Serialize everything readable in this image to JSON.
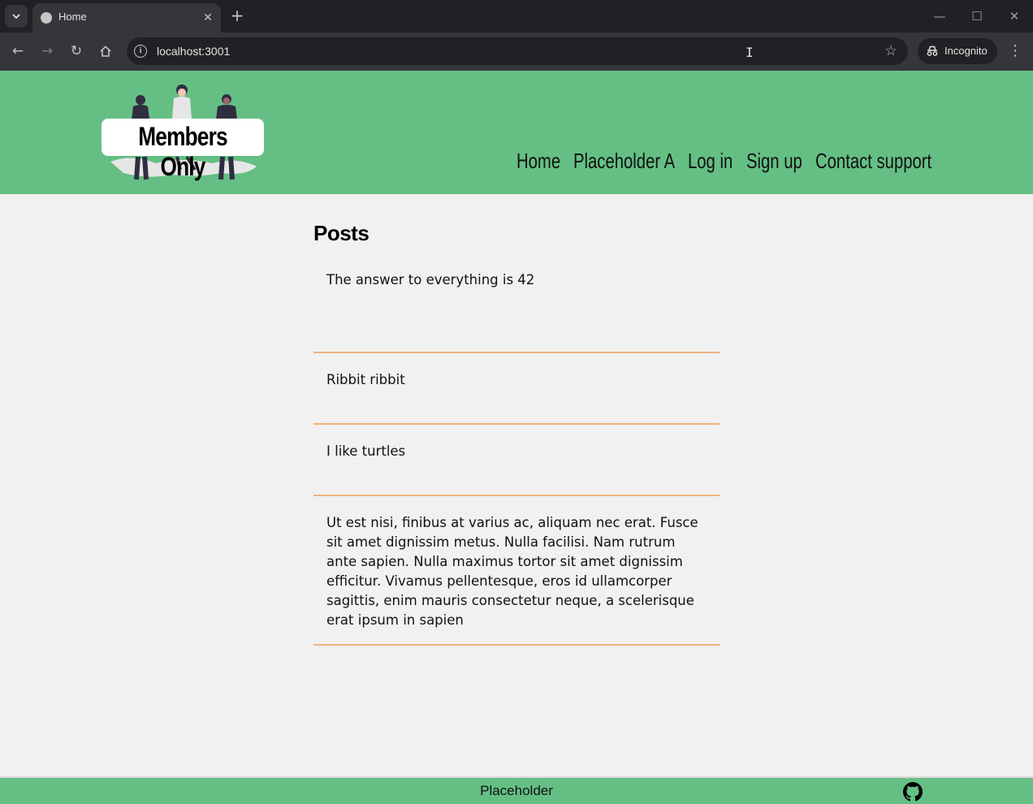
{
  "browser": {
    "tab_title": "Home",
    "url": "localhost:3001",
    "incognito_label": "Incognito",
    "icons": [
      "tab-search-icon",
      "globe-icon",
      "close-icon",
      "plus-icon",
      "minimize-icon",
      "maximize-icon",
      "back-icon",
      "forward-icon",
      "reload-icon",
      "home-icon",
      "site-info-icon",
      "bookmark-star-icon",
      "incognito-icon",
      "menu-icon"
    ]
  },
  "header": {
    "logo_text": "Members Only",
    "nav": [
      "Home",
      "Placeholder A",
      "Log in",
      "Sign up",
      "Contact support"
    ],
    "background_color": "#65bf84"
  },
  "main": {
    "heading": "Posts",
    "posts": [
      "The answer to everything is 42",
      "Ribbit ribbit",
      "I like turtles",
      "Ut est nisi, finibus at varius ac, aliquam nec erat. Fusce sit amet dignissim metus. Nulla facilisi. Nam rutrum ante sapien. Nulla maximus tortor sit amet dignissim efficitur. Vivamus pellentesque, eros id ullamcorper sagittis, enim mauris consectetur neque, a scelerisque erat ipsum in sapien"
    ],
    "divider_color": "#eeb27a"
  },
  "footer": {
    "text": "Placeholder",
    "icon": "github-icon"
  }
}
